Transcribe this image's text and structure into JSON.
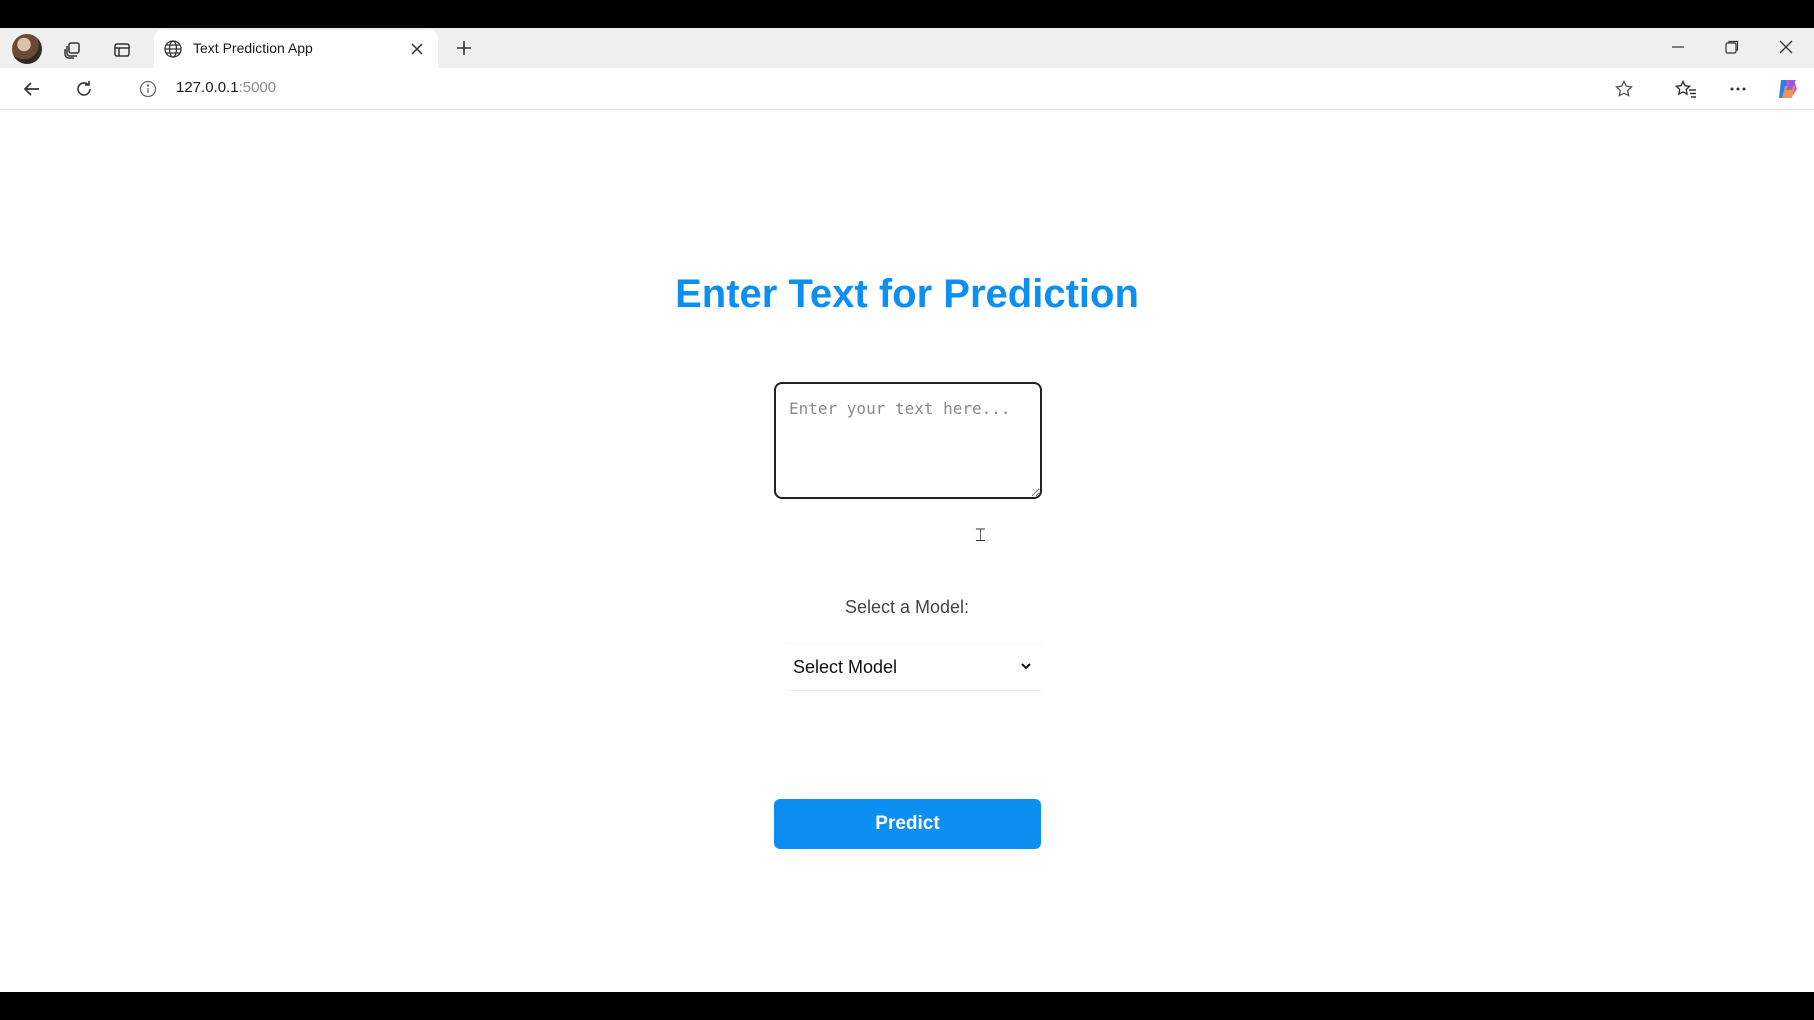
{
  "browser": {
    "tab_title": "Text Prediction App",
    "url_host": "127.0.0.1",
    "url_port": ":5000"
  },
  "page": {
    "heading": "Enter Text for Prediction",
    "textarea_placeholder": "Enter your text here...",
    "model_label": "Select a Model:",
    "model_select_value": "Select Model",
    "predict_label": "Predict"
  },
  "colors": {
    "accent": "#0d8ff2"
  }
}
